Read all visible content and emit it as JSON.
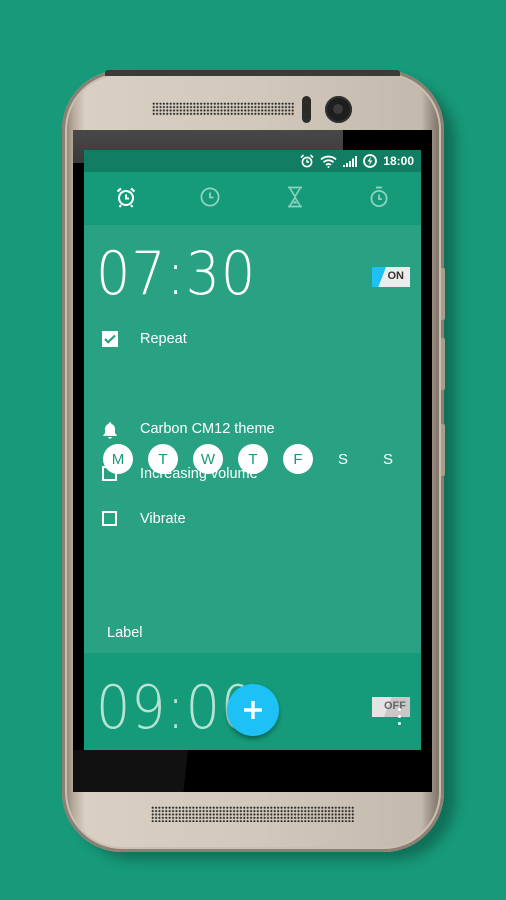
{
  "status_bar": {
    "icons": [
      "alarm-icon",
      "wifi-icon",
      "signal-icon",
      "battery-charging-icon"
    ],
    "time": "18:00"
  },
  "tabs": [
    {
      "name": "alarm",
      "icon": "alarm-clock-icon",
      "active": true
    },
    {
      "name": "clock",
      "icon": "clock-icon",
      "active": false
    },
    {
      "name": "timer",
      "icon": "hourglass-icon",
      "active": false
    },
    {
      "name": "stopwatch",
      "icon": "stopwatch-icon",
      "active": false
    }
  ],
  "alarms": [
    {
      "time": "07:30",
      "enabled": true,
      "toggle_label": "ON",
      "expanded": true,
      "repeat": {
        "label": "Repeat",
        "checked": true
      },
      "days": [
        {
          "label": "M",
          "active": true
        },
        {
          "label": "T",
          "active": true
        },
        {
          "label": "W",
          "active": true
        },
        {
          "label": "T",
          "active": true
        },
        {
          "label": "F",
          "active": true
        },
        {
          "label": "S",
          "active": false
        },
        {
          "label": "S",
          "active": false
        }
      ],
      "ringtone": "Carbon CM12 theme",
      "increasing_volume": {
        "label": "Increasing volume",
        "checked": false
      },
      "vibrate": {
        "label": "Vibrate",
        "checked": false
      },
      "label_placeholder": "Label"
    },
    {
      "time": "09:00",
      "enabled": false,
      "toggle_label": "OFF",
      "expanded": false
    }
  ],
  "colors": {
    "background": "#179a7a",
    "primary": "#159b79",
    "primary_dark": "#117d62",
    "card": "#28a283",
    "accent": "#1ec1f5"
  }
}
